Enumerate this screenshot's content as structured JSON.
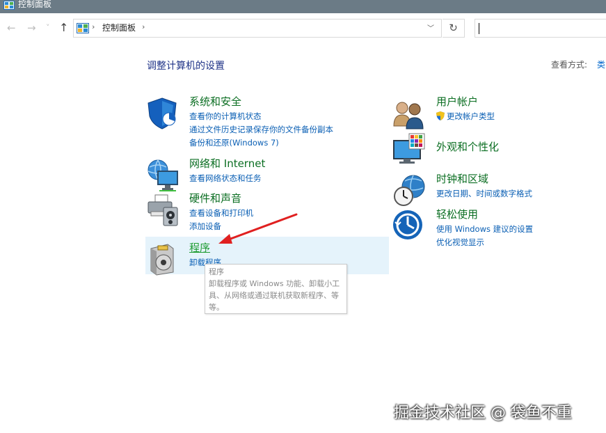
{
  "window": {
    "title": "控制面板"
  },
  "navigation": {
    "back_glyph": "←",
    "forward_glyph": "→",
    "recent_glyph": "˅",
    "up_glyph": "↑",
    "breadcrumb": [
      "控制面板"
    ],
    "separator_glyph": "›",
    "dropdown_glyph": "﹀",
    "refresh_glyph": "↻",
    "search_value": ""
  },
  "main": {
    "heading": "调整计算机的设置",
    "view_by_label": "查看方式:",
    "view_by_value": "类"
  },
  "categories": {
    "system_security": {
      "title": "系统和安全",
      "links": [
        "查看你的计算机状态",
        "通过文件历史记录保存你的文件备份副本",
        "备份和还原(Windows 7)"
      ],
      "icon": "shield-icon"
    },
    "network": {
      "title": "网络和 Internet",
      "links": [
        "查看网络状态和任务"
      ],
      "icon": "network-globe-icon"
    },
    "hardware": {
      "title": "硬件和声音",
      "links": [
        "查看设备和打印机",
        "添加设备"
      ],
      "icon": "printer-icon"
    },
    "programs": {
      "title": "程序",
      "links": [
        "卸载程序"
      ],
      "icon": "programs-disc-icon"
    },
    "user_accounts": {
      "title": "用户帐户",
      "links": [
        "更改帐户类型"
      ],
      "icon": "users-icon"
    },
    "appearance": {
      "title": "外观和个性化",
      "icon": "monitor-palette-icon"
    },
    "clock_region": {
      "title": "时钟和区域",
      "links": [
        "更改日期、时间或数字格式"
      ],
      "icon": "clock-globe-icon"
    },
    "ease_access": {
      "title": "轻松使用",
      "links": [
        "使用 Windows 建议的设置",
        "优化视觉显示"
      ],
      "icon": "ease-of-access-icon"
    }
  },
  "tooltip": {
    "title": "程序",
    "description": "卸载程序或 Windows 功能、卸载小工具、从网络或通过联机获取新程序、等等。"
  },
  "annotation": {
    "arrow_color": "#e02020"
  },
  "watermark": "掘金技术社区 @ 袋鱼不重",
  "colors": {
    "title_bar": "#6b7b86",
    "category_title": "#0b6e22",
    "link": "#0a5fb4",
    "hover_highlight": "#e5f3fb"
  }
}
